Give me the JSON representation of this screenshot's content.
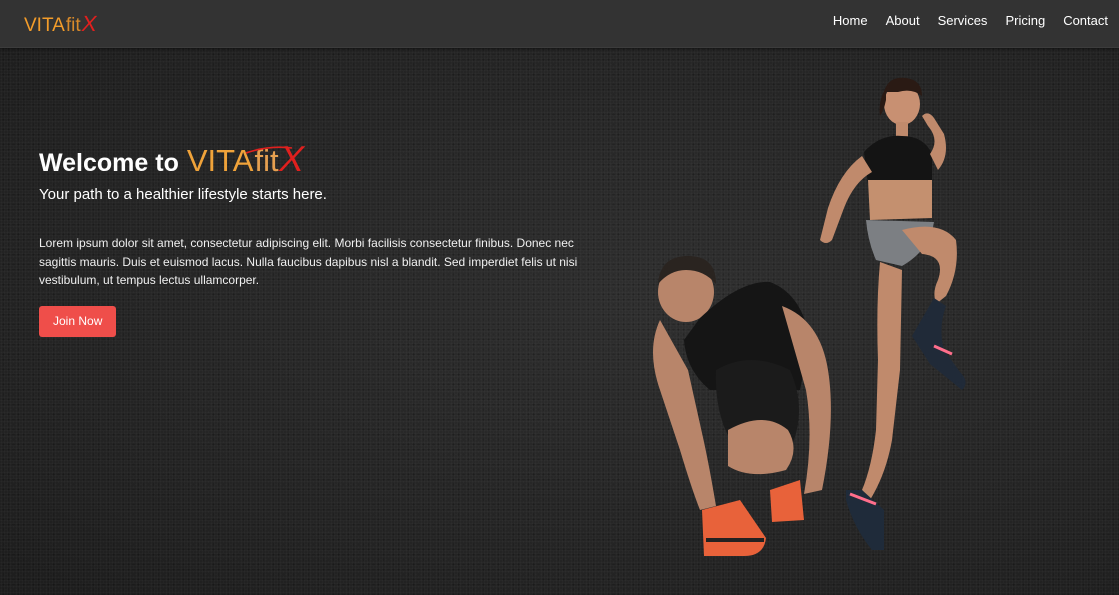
{
  "brand": {
    "part1": "VITA",
    "part2": "fit",
    "part3": "X",
    "colors": {
      "vita": "#f39c2a",
      "fit": "#d98a2a",
      "x": "#e0201e"
    }
  },
  "nav": {
    "links": [
      {
        "label": "Home"
      },
      {
        "label": "About"
      },
      {
        "label": "Services"
      },
      {
        "label": "Pricing"
      },
      {
        "label": "Contact"
      }
    ]
  },
  "hero": {
    "title_prefix": "Welcome to",
    "subtitle": "Your path to a healthier lifestyle starts here.",
    "body": "Lorem ipsum dolor sit amet, consectetur adipiscing elit. Morbi facilisis consectetur finibus. Donec nec sagittis mauris. Duis et euismod lacus. Nulla faucibus dapibus nisl a blandit. Sed imperdiet felis ut nisi vestibulum, ut tempus lectus ullamcorper.",
    "cta_label": "Join Now",
    "cta_color": "#ef4e4a"
  },
  "image": {
    "icon": "athletes-photo"
  }
}
